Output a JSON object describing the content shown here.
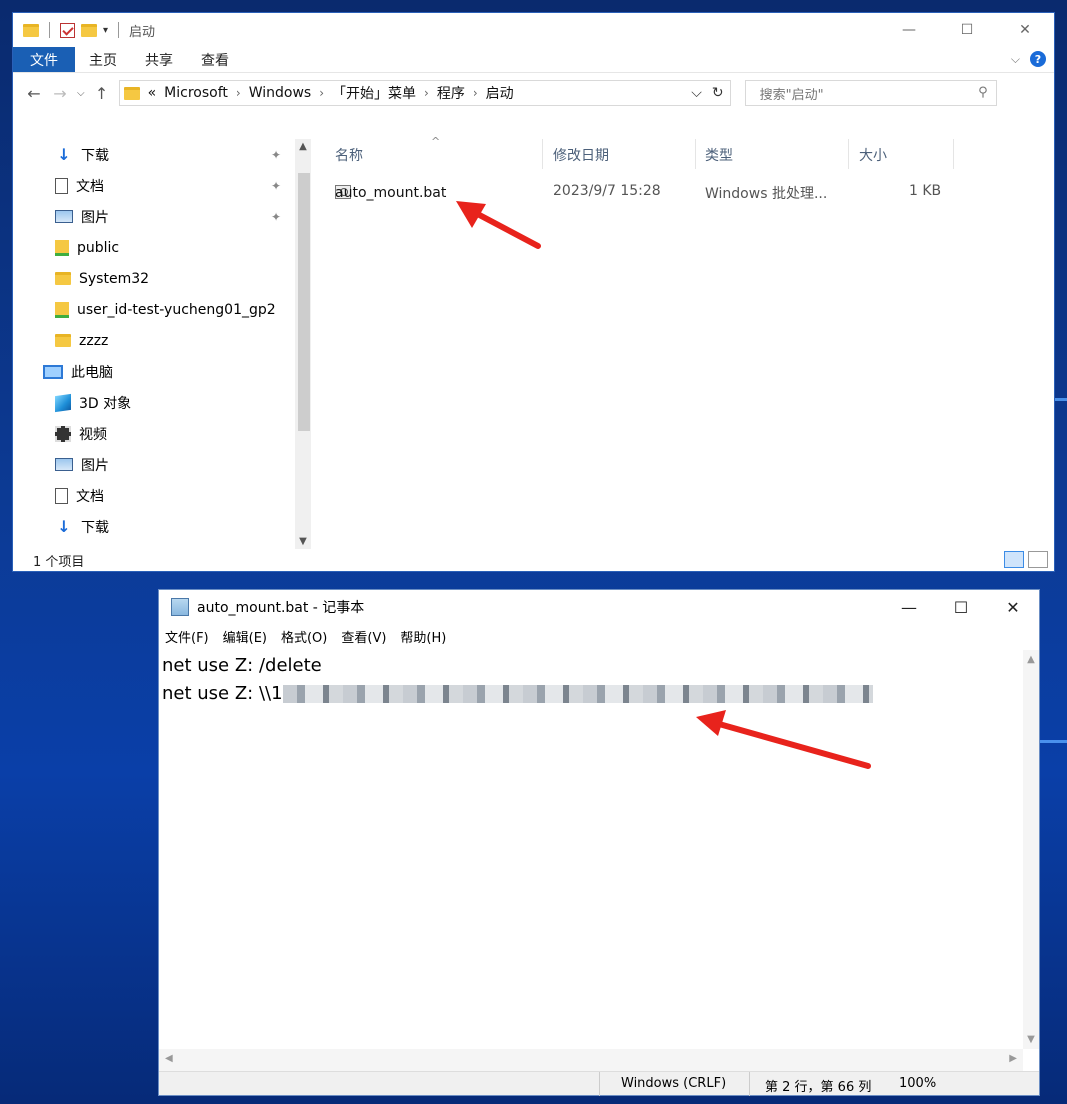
{
  "explorer": {
    "title": "启动",
    "ribbon": {
      "file": "文件",
      "tabs": [
        "主页",
        "共享",
        "查看"
      ]
    },
    "address": {
      "overflow": "«",
      "crumbs": [
        "Microsoft",
        "Windows",
        "「开始」菜单",
        "程序",
        "启动"
      ]
    },
    "search_placeholder": "搜索\"启动\"",
    "nav": [
      {
        "label": "下载",
        "icon": "download-arrow-icon",
        "pinned": true
      },
      {
        "label": "文档",
        "icon": "document-icon",
        "pinned": true
      },
      {
        "label": "图片",
        "icon": "picture-icon",
        "pinned": true
      },
      {
        "label": "public",
        "icon": "user-folder-icon"
      },
      {
        "label": "System32",
        "icon": "folder-icon"
      },
      {
        "label": "user_id-test-yucheng01_gp2",
        "icon": "user-folder-icon"
      },
      {
        "label": "zzzz",
        "icon": "folder-icon"
      },
      {
        "label": "此电脑",
        "icon": "computer-icon"
      },
      {
        "label": "3D 对象",
        "icon": "3d-objects-icon"
      },
      {
        "label": "视频",
        "icon": "video-icon"
      },
      {
        "label": "图片",
        "icon": "picture-icon"
      },
      {
        "label": "文档",
        "icon": "document-icon"
      },
      {
        "label": "下载",
        "icon": "download-arrow-icon"
      }
    ],
    "columns": {
      "name": "名称",
      "modified": "修改日期",
      "type": "类型",
      "size": "大小"
    },
    "file": {
      "name": "auto_mount.bat",
      "modified": "2023/9/7 15:28",
      "type": "Windows 批处理...",
      "size": "1 KB"
    },
    "status": "1 个项目"
  },
  "notepad": {
    "title": "auto_mount.bat - 记事本",
    "menu": [
      "文件(F)",
      "编辑(E)",
      "格式(O)",
      "查看(V)",
      "帮助(H)"
    ],
    "lines": [
      "net use Z: /delete",
      "net use Z: \\\\1"
    ],
    "status": {
      "encoding": "Windows (CRLF)",
      "position": "第 2 行，第 66 列",
      "zoom": "100%"
    }
  },
  "colors": {
    "accent": "#1a5fb4",
    "annotation": "#e8231c",
    "desktop": "#0c3a94"
  }
}
